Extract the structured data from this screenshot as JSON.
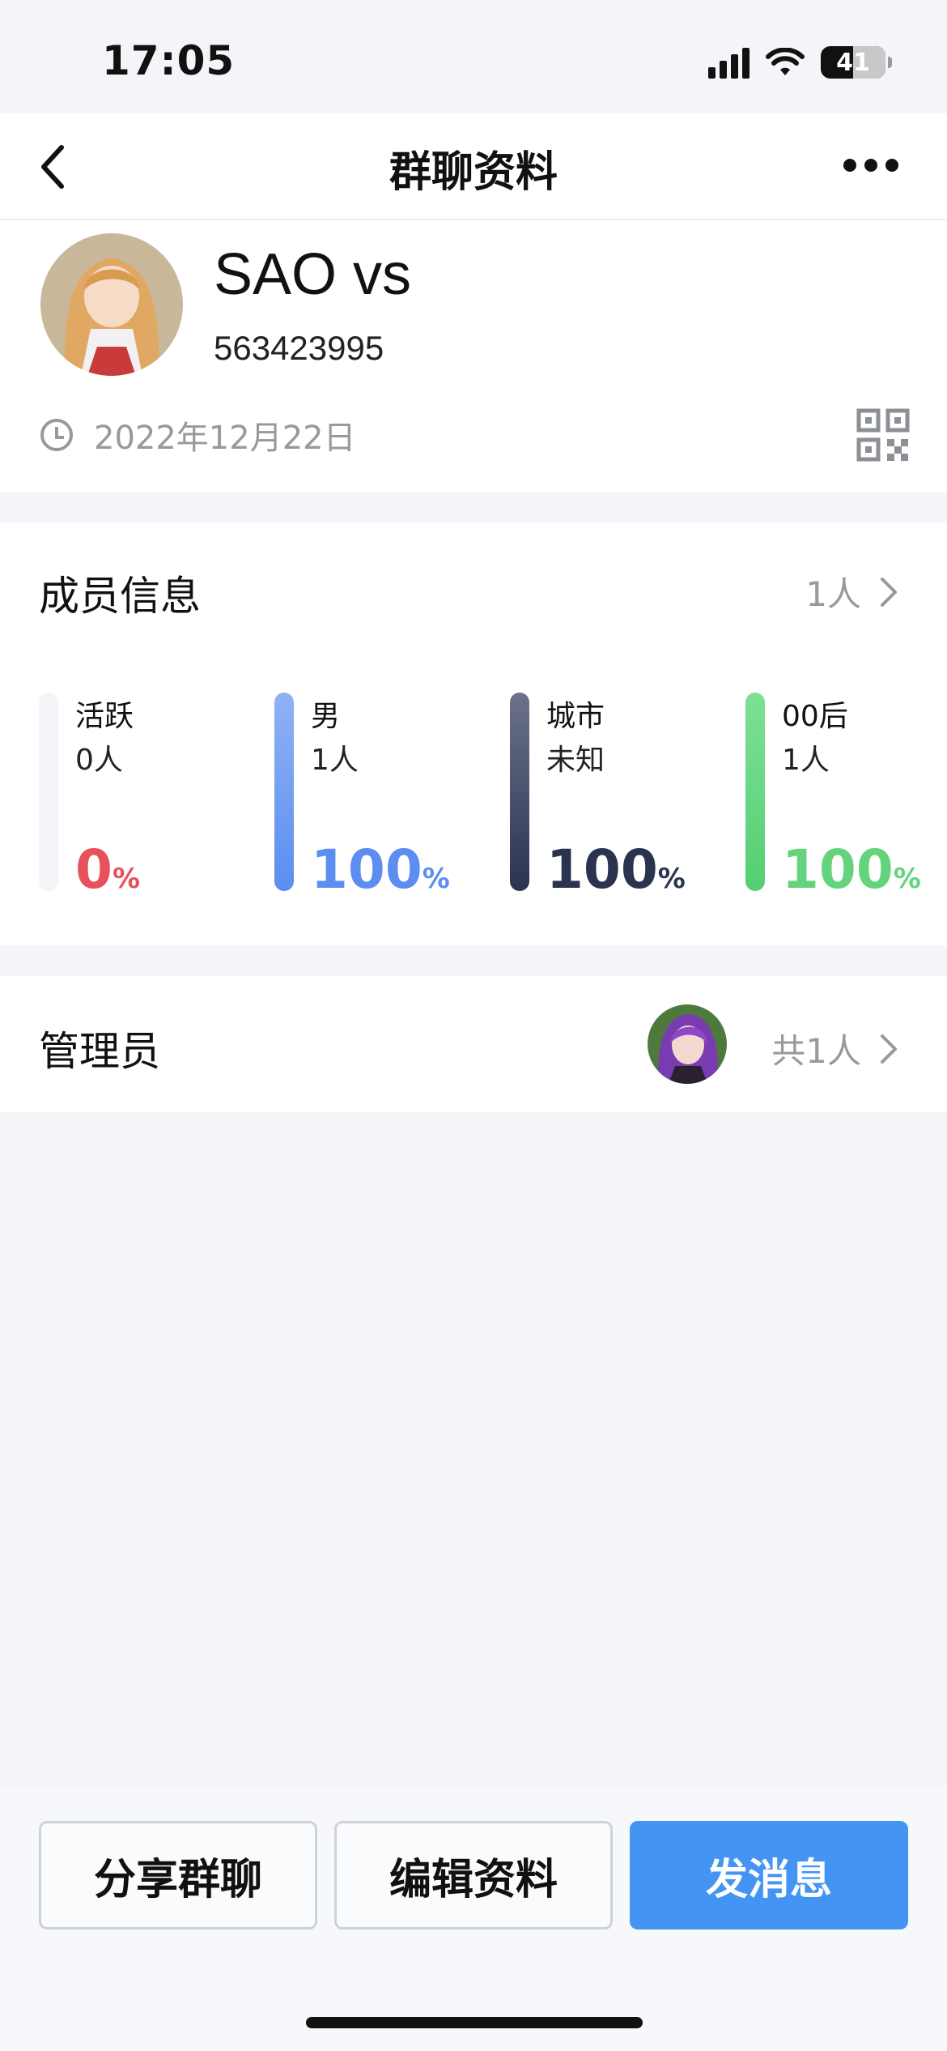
{
  "status_bar": {
    "time": "17:05",
    "battery": "41",
    "icons": [
      "signal-icon",
      "wifi-icon",
      "battery-icon"
    ]
  },
  "nav": {
    "title": "群聊资料",
    "back_icon": "chevron-left-icon",
    "more_icon": "more-horizontal-icon"
  },
  "group": {
    "name": "SAO vs",
    "id": "563423995",
    "created_date": "2022年12月22日",
    "date_icon": "clock-icon",
    "qr_icon": "qr-code-icon"
  },
  "members": {
    "title": "成员信息",
    "count": "1人",
    "stats": [
      {
        "label": "活跃",
        "sub": "0人",
        "value": "0",
        "unit": "%",
        "color": "#e8515b",
        "bar_top": "#f3f4f7",
        "bar_bottom": "#f3f4f7"
      },
      {
        "label": "男",
        "sub": "1人",
        "value": "100",
        "unit": "%",
        "color": "#5b8ef0",
        "bar_top": "#8fb2f5",
        "bar_bottom": "#5b8ef0"
      },
      {
        "label": "城市",
        "sub": "未知",
        "value": "100",
        "unit": "%",
        "color": "#2b3350",
        "bar_top": "#6b728a",
        "bar_bottom": "#2b3350"
      },
      {
        "label": "00后",
        "sub": "1人",
        "value": "100",
        "unit": "%",
        "color": "#63d47d",
        "bar_top": "#7de096",
        "bar_bottom": "#55cf72"
      }
    ]
  },
  "admins": {
    "title": "管理员",
    "count": "共1人"
  },
  "actions": {
    "share": "分享群聊",
    "edit": "编辑资料",
    "send": "发消息"
  },
  "colors": {
    "accent": "#4394f3",
    "background": "#f3f5f9"
  }
}
